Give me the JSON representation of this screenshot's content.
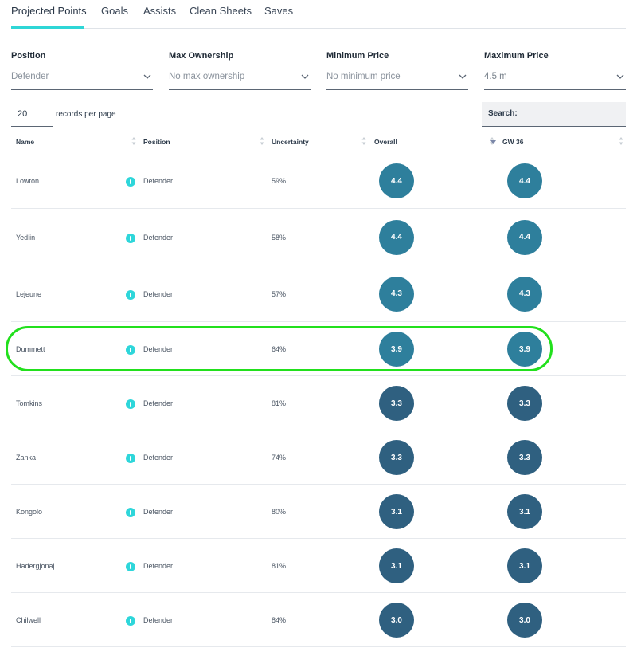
{
  "tabs": [
    {
      "label": "Projected Points",
      "active": true
    },
    {
      "label": "Goals",
      "active": false
    },
    {
      "label": "Assists",
      "active": false
    },
    {
      "label": "Clean Sheets",
      "active": false
    },
    {
      "label": "Saves",
      "active": false
    }
  ],
  "filters": [
    {
      "label": "Position",
      "value": "Defender"
    },
    {
      "label": "Max Ownership",
      "value": "No max ownership"
    },
    {
      "label": "Minimum Price",
      "value": "No minimum price"
    },
    {
      "label": "Maximum Price",
      "value": "4.5 m"
    }
  ],
  "pagination": {
    "records_value": "20",
    "records_label": "records per page"
  },
  "search": {
    "label": "Search:"
  },
  "columns": [
    "Name",
    "Position",
    "Uncertainty",
    "Overall",
    "GW 36"
  ],
  "sorted_column": "GW 36",
  "rows": [
    {
      "name": "Lowton",
      "position": "Defender",
      "uncertainty": "59%",
      "overall": "4.4",
      "gw": "4.4"
    },
    {
      "name": "Yedlin",
      "position": "Defender",
      "uncertainty": "58%",
      "overall": "4.4",
      "gw": "4.4"
    },
    {
      "name": "Lejeune",
      "position": "Defender",
      "uncertainty": "57%",
      "overall": "4.3",
      "gw": "4.3"
    },
    {
      "name": "Dummett",
      "position": "Defender",
      "uncertainty": "64%",
      "overall": "3.9",
      "gw": "3.9"
    },
    {
      "name": "Tomkins",
      "position": "Defender",
      "uncertainty": "81%",
      "overall": "3.3",
      "gw": "3.3"
    },
    {
      "name": "Zanka",
      "position": "Defender",
      "uncertainty": "74%",
      "overall": "3.3",
      "gw": "3.3"
    },
    {
      "name": "Kongolo",
      "position": "Defender",
      "uncertainty": "80%",
      "overall": "3.1",
      "gw": "3.1"
    },
    {
      "name": "Hadergjonaj",
      "position": "Defender",
      "uncertainty": "81%",
      "overall": "3.1",
      "gw": "3.1"
    },
    {
      "name": "Chilwell",
      "position": "Defender",
      "uncertainty": "84%",
      "overall": "3.0",
      "gw": "3.0"
    }
  ],
  "highlighted_row": "Dummett",
  "colors": {
    "accent": "#2fd6d6",
    "highlight": "#22e01d",
    "bubble_high": "#2e7f9c",
    "bubble_low": "#2f6080"
  }
}
